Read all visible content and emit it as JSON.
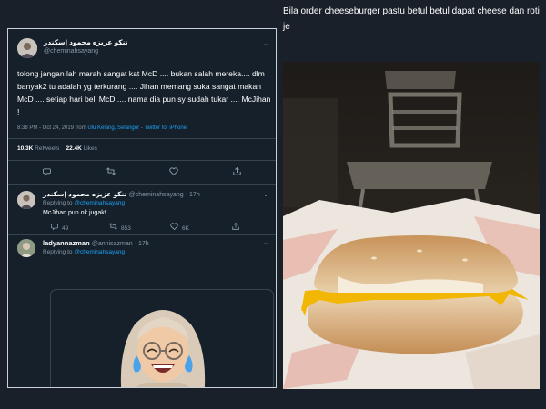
{
  "caption": "Bila order cheeseburger pastu betul betul dapat cheese dan roti je",
  "tweet": {
    "display_name": "تنكو عزيزه محمود إسكندر",
    "handle": "@cheminahsayang",
    "text": "tolong jangan lah marah sangat kat McD .... bukan salah mereka.... dlm banyak2 tu adalah yg terkurang .... Jihan memang suka sangat makan McD .... setiap hari beli McD .... nama dia pun sy sudah tukar .... McJihan !",
    "time": "8:38 PM - Oct 24, 2019 from",
    "location": "Ulu Kelang, Selangor",
    "separator": "-",
    "client": "Twitter for iPhone",
    "retweets_count": "10.3K",
    "retweets_label": "Retweets",
    "likes_count": "22.4K",
    "likes_label": "Likes"
  },
  "replies": [
    {
      "display_name": "تنكو عزيزه محمود إسكندر",
      "handle": "@cheminahsayang",
      "age": "· 17h",
      "replying_label": "Replying to",
      "replying_to": "@cheminahsayang",
      "text": "McJihan pun ok jugak!",
      "reply_count": "49",
      "retweet_count": "853",
      "like_count": "6K"
    },
    {
      "display_name": "ladyannazman",
      "handle": "@annisazman",
      "age": "· 17h",
      "replying_label": "Replying to",
      "replying_to": "@cheminahsayang"
    }
  ],
  "icons": {
    "reply": "reply-icon",
    "retweet": "retweet-icon",
    "like": "heart-icon",
    "share": "share-icon",
    "chevron": "chevron-down-icon"
  },
  "colors": {
    "tweet_bg": "#15202b",
    "page_bg": "#1a2029",
    "link": "#1da1f2",
    "muted": "#8899a6",
    "cheese": "#f2b705"
  }
}
